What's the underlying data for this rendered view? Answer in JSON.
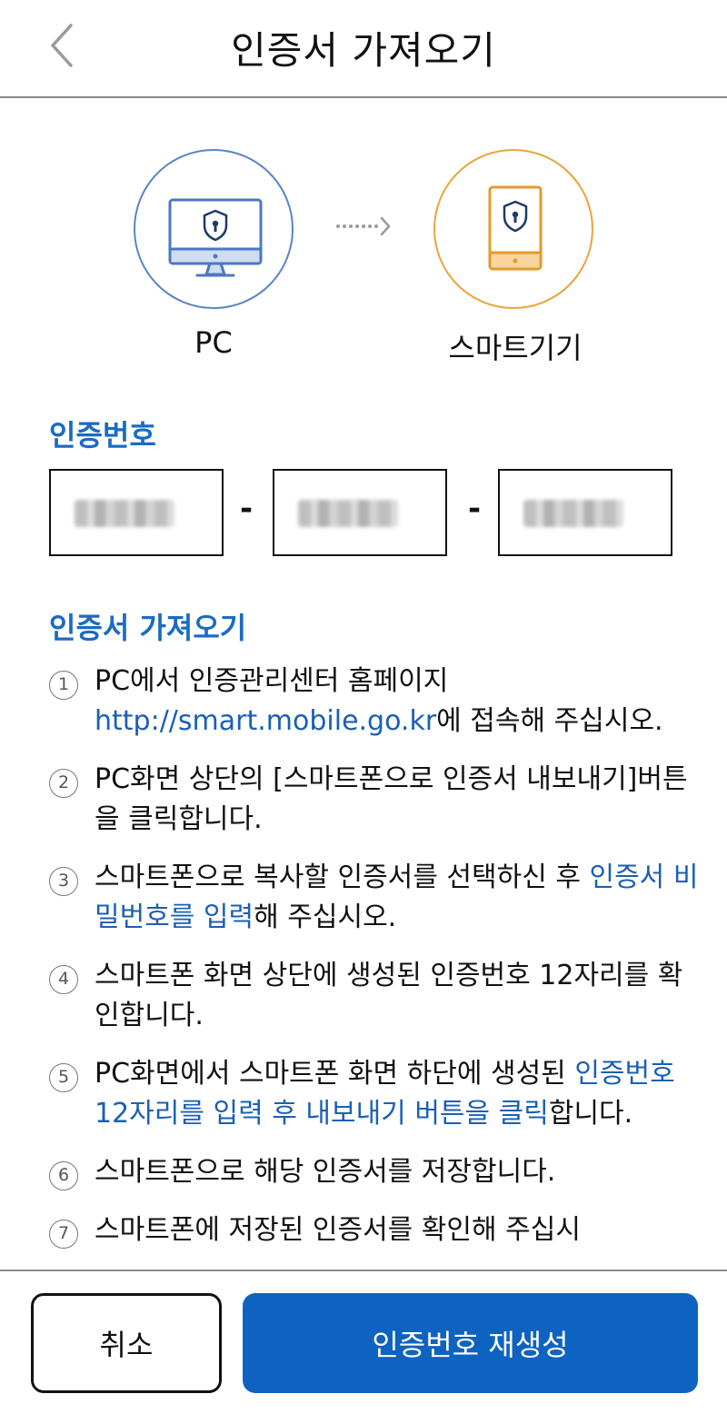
{
  "header": {
    "title": "인증서 가져오기",
    "back_icon": "chevron-left-icon"
  },
  "diagram": {
    "source_label": "PC",
    "target_label": "스마트기기",
    "source_icon": "monitor-shield-icon",
    "target_icon": "phone-shield-icon",
    "source_color": "#5a85c6",
    "target_color": "#e9a43c"
  },
  "auth_code": {
    "title": "인증번호",
    "separator": "-",
    "values": [
      "",
      "",
      ""
    ]
  },
  "import_section": {
    "title": "인증서 가져오기",
    "steps": [
      {
        "num": "1",
        "parts": [
          {
            "text": "PC에서 인증관리센터 홈페이지 ",
            "link": false
          },
          {
            "text": "http://smart.mobile.go.kr",
            "link": true
          },
          {
            "text": "에 접속해 주십시오.",
            "link": false
          }
        ]
      },
      {
        "num": "2",
        "parts": [
          {
            "text": "PC화면 상단의 [스마트폰으로 인증서 내보내기]버튼을 클릭합니다.",
            "link": false
          }
        ]
      },
      {
        "num": "3",
        "parts": [
          {
            "text": "스마트폰으로 복사할 인증서를 선택하신 후 ",
            "link": false
          },
          {
            "text": "인증서 비밀번호를 입력",
            "link": true
          },
          {
            "text": "해 주십시오.",
            "link": false
          }
        ]
      },
      {
        "num": "4",
        "parts": [
          {
            "text": "스마트폰 화면 상단에 생성된 인증번호 12자리를 확인합니다.",
            "link": false
          }
        ]
      },
      {
        "num": "5",
        "parts": [
          {
            "text": "PC화면에서 스마트폰 화면 하단에 생성된 ",
            "link": false
          },
          {
            "text": "인증번호 12자리를 입력 후 내보내기 버튼을 클릭",
            "link": true
          },
          {
            "text": "합니다.",
            "link": false
          }
        ]
      },
      {
        "num": "6",
        "parts": [
          {
            "text": "스마트폰으로 해당 인증서를 저장합니다.",
            "link": false
          }
        ]
      },
      {
        "num": "7",
        "parts": [
          {
            "text": "스마트폰에 저장된 인증서를 확인해 주십시",
            "link": false
          }
        ]
      }
    ],
    "link_color": "#1a5fb4"
  },
  "footer": {
    "cancel_label": "취소",
    "regenerate_label": "인증번호 재생성",
    "primary_color": "#0e63c0"
  }
}
